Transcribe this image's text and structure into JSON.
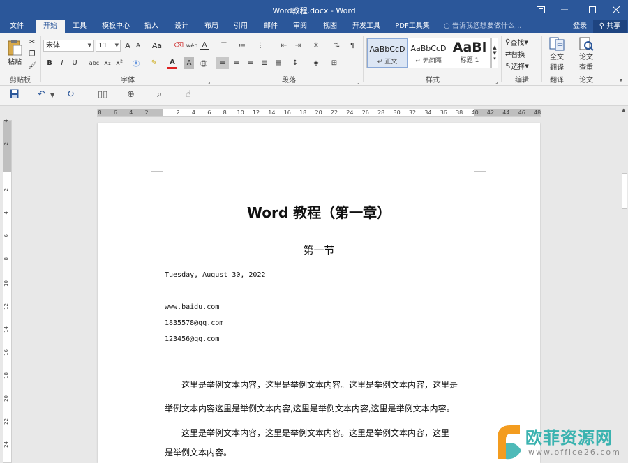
{
  "window": {
    "title": "Word教程.docx - Word"
  },
  "tabs": [
    {
      "label": "文件",
      "active": false
    },
    {
      "label": "开始",
      "active": true
    },
    {
      "label": "工具",
      "active": false
    },
    {
      "label": "模板中心",
      "active": false
    },
    {
      "label": "插入",
      "active": false
    },
    {
      "label": "设计",
      "active": false
    },
    {
      "label": "布局",
      "active": false
    },
    {
      "label": "引用",
      "active": false
    },
    {
      "label": "邮件",
      "active": false
    },
    {
      "label": "审阅",
      "active": false
    },
    {
      "label": "视图",
      "active": false
    },
    {
      "label": "开发工具",
      "active": false
    },
    {
      "label": "PDF工具集",
      "active": false
    }
  ],
  "tell_me": "告诉我您想要做什么...",
  "account": {
    "login": "登录",
    "share": "共享"
  },
  "ribbon": {
    "clipboard": {
      "paste": "粘贴",
      "label": "剪贴板"
    },
    "font": {
      "name": "宋体",
      "size": "11",
      "grow": "A",
      "shrink": "A",
      "case": "Aa",
      "phonetic": "wén",
      "bold": "B",
      "italic": "I",
      "underline": "U",
      "strike": "abc",
      "sub": "x₂",
      "sup": "x²",
      "color_a": "A",
      "label": "字体"
    },
    "paragraph": {
      "label": "段落"
    },
    "styles": {
      "items": [
        {
          "preview": "AaBbCcD",
          "name": "↵ 正文"
        },
        {
          "preview": "AaBbCcD",
          "name": "↵ 无间隔"
        },
        {
          "preview": "AaBl",
          "name": "标题 1"
        }
      ],
      "label": "样式"
    },
    "editing": {
      "find": "查找",
      "replace": "替换",
      "select": "选择",
      "label": "编辑"
    },
    "translate": {
      "btn1": "全文",
      "btn2": "翻译",
      "label": "翻译"
    },
    "paper": {
      "btn1": "论文",
      "btn2": "查重",
      "label": "论文"
    }
  },
  "ruler": {
    "h_ticks": [
      "8",
      "6",
      "4",
      "2",
      "",
      "2",
      "4",
      "6",
      "8",
      "10",
      "12",
      "14",
      "16",
      "18",
      "20",
      "22",
      "24",
      "26",
      "28",
      "30",
      "32",
      "34",
      "36",
      "38",
      "40",
      "42",
      "44",
      "46",
      "48"
    ],
    "v_ticks": [
      "4",
      "2",
      "",
      "2",
      "4",
      "6",
      "8",
      "10",
      "12",
      "14",
      "16",
      "18",
      "20",
      "22",
      "24"
    ],
    "corner": "L"
  },
  "document": {
    "title": "Word 教程（第一章）",
    "subtitle": "第一节",
    "date": "Tuesday, August 30, 2022",
    "lines": [
      "www.baidu.com",
      "1835578@qq.com",
      "123456@qq.com"
    ],
    "paragraphs": [
      "　　这里是举例文本内容，这里是举例文本内容。这里是举例文本内容，这里是",
      "举例文本内容这里是举例文本内容,这里是举例文本内容,这里是举例文本内容。",
      "　　这里是举例文本内容，这里是举例文本内容。这里是举例文本内容，这里",
      "是举例文本内容。"
    ]
  },
  "watermark": {
    "brand": "欧菲资源网",
    "url": "www.office26.com"
  },
  "colors": {
    "accent": "#2b579a",
    "brand_orange": "#f39c1f",
    "brand_teal": "#3bb3b0"
  }
}
